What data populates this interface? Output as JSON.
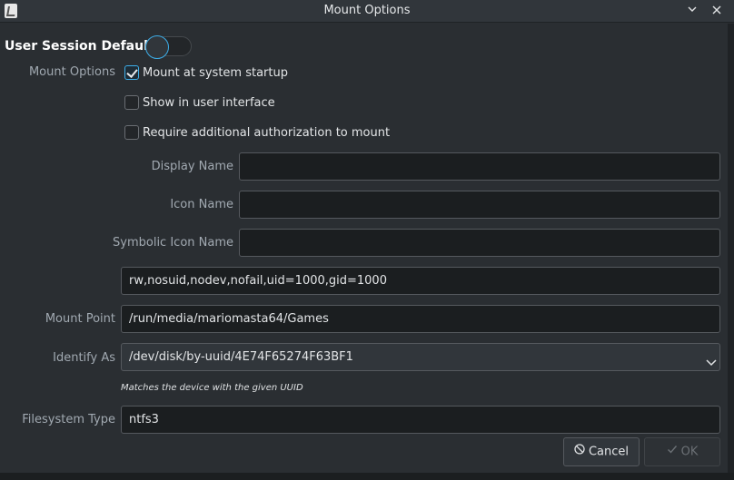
{
  "window": {
    "title": "Mount Options"
  },
  "section": {
    "title": "User Session Defaults",
    "toggle_on": false
  },
  "mount_options": {
    "label": "Mount Options",
    "checkboxes": [
      {
        "label": "Mount at system startup",
        "checked": true
      },
      {
        "label": "Show in user interface",
        "checked": false
      },
      {
        "label": "Require additional authorization to mount",
        "checked": false
      }
    ]
  },
  "fields": {
    "display_name": {
      "label": "Display Name",
      "value": ""
    },
    "icon_name": {
      "label": "Icon Name",
      "value": ""
    },
    "symbolic_icon_name": {
      "label": "Symbolic Icon Name",
      "value": ""
    },
    "options": {
      "value": "rw,nosuid,nodev,nofail,uid=1000,gid=1000"
    },
    "mount_point": {
      "label": "Mount Point",
      "value": "/run/media/mariomasta64/Games"
    },
    "identify_as": {
      "label": "Identify As",
      "value": "/dev/disk/by-uuid/4E74F65274F63BF1",
      "hint": "Matches the device with the given UUID"
    },
    "filesystem_type": {
      "label": "Filesystem Type",
      "value": "ntfs3"
    }
  },
  "buttons": {
    "cancel": "Cancel",
    "ok": "OK"
  },
  "colors": {
    "accent": "#3daee9",
    "window_bg": "#2a2e32",
    "field_bg": "#1b1e20"
  },
  "icons": [
    "app-icon",
    "minimize-icon",
    "close-icon",
    "chevron-down-icon",
    "cancel-icon",
    "check-icon"
  ]
}
